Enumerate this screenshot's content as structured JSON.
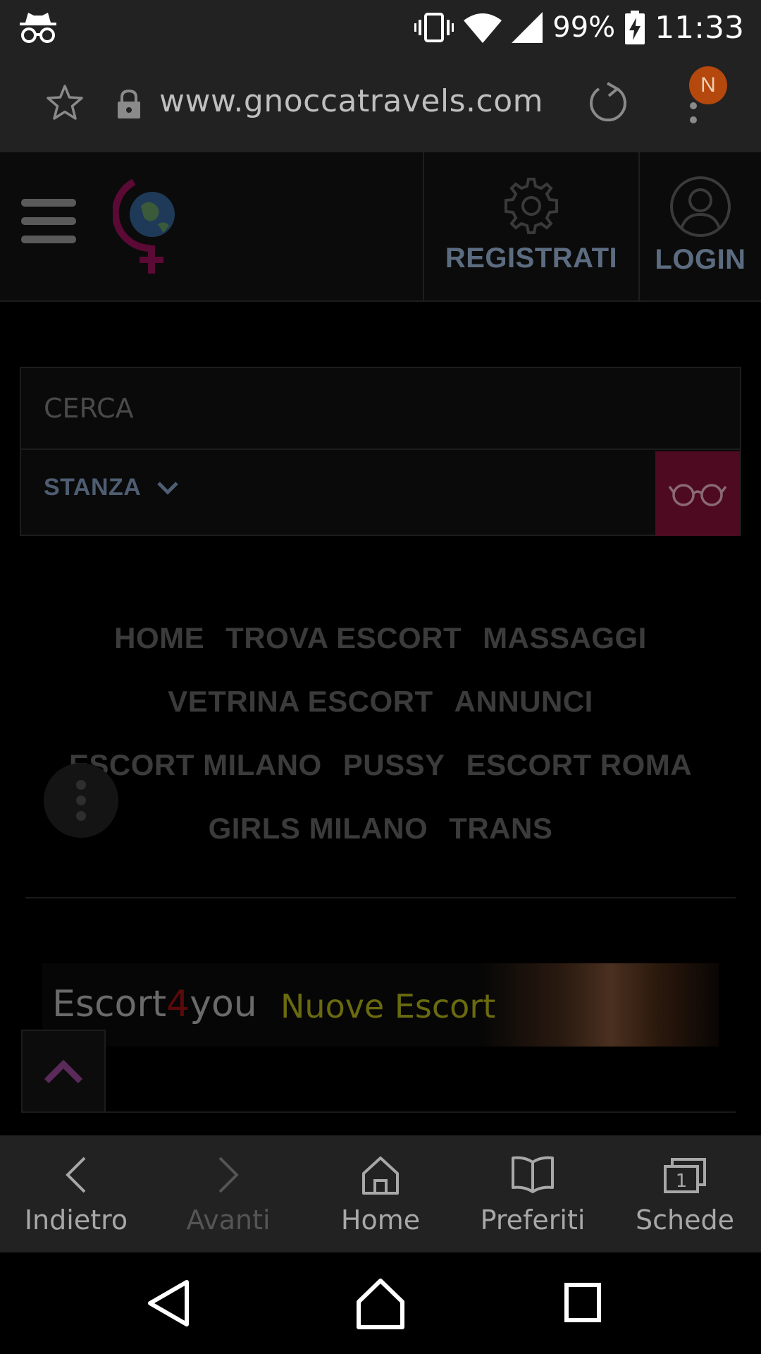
{
  "status_bar": {
    "battery": "99%",
    "time": "11:33"
  },
  "url_bar": {
    "url": "www.gnoccatravels.com",
    "avatar_letter": "N",
    "avatar_color": "#b5480c"
  },
  "header": {
    "register_label": "REGISTRATI",
    "login_label": "LOGIN"
  },
  "search": {
    "placeholder": "CERCA",
    "category": "STANZA"
  },
  "nav": {
    "rows": [
      [
        "HOME",
        "TROVA ESCORT",
        "MASSAGGI"
      ],
      [
        "VETRINA ESCORT",
        "ANNUNCI"
      ],
      [
        "ESCORT MILANO",
        "PUSSY",
        "ESCORT ROMA"
      ],
      [
        "GIRLS MILANO",
        "TRANS"
      ]
    ]
  },
  "banner": {
    "brand_left": "Escort",
    "brand_mid": "4",
    "brand_right": "you",
    "tagline": "Nuove Escort"
  },
  "bottom_bar": {
    "back": "Indietro",
    "forward": "Avanti",
    "home": "Home",
    "bookmarks": "Preferiti",
    "tabs": "Schede",
    "tab_count": "1"
  },
  "colors": {
    "accent": "#4e0a20",
    "link_blue": "#5c6c80",
    "to_top_arrow": "#5a2a5a"
  }
}
